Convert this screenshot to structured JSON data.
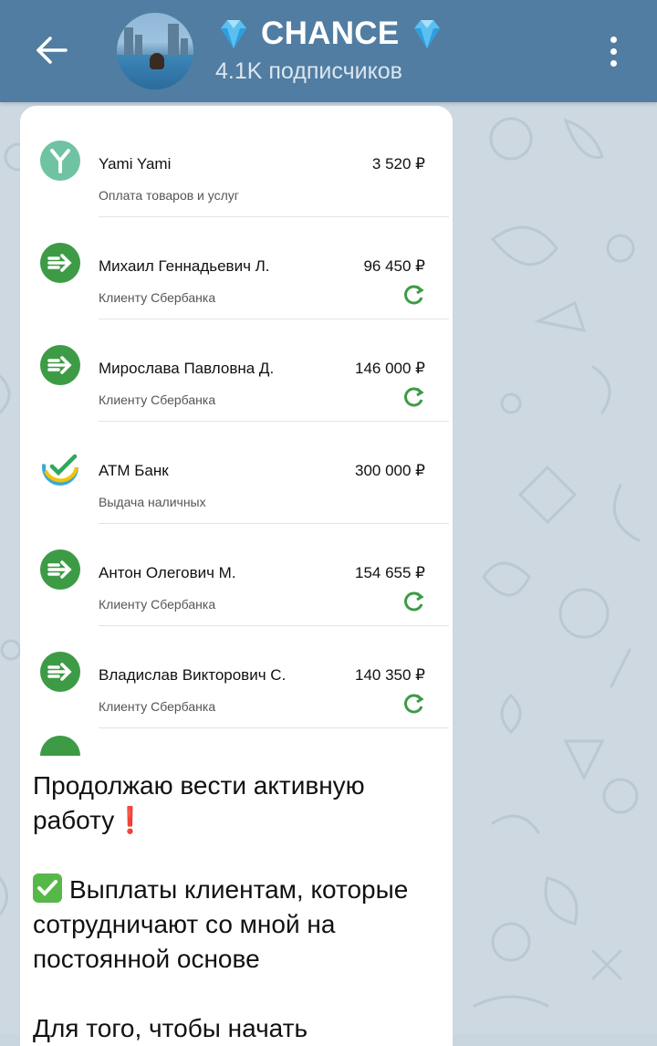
{
  "header": {
    "title": "CHANCE",
    "subtitle": "4.1K подписчиков",
    "left_emoji": "diamond-icon",
    "right_emoji": "diamond-icon",
    "color": "#517da2"
  },
  "transactions": [
    {
      "name": "Yami Yami",
      "amount": "3 520 ₽",
      "desc": "Оплата товаров и услуг",
      "icon": "yami-logo-icon",
      "repeat": false
    },
    {
      "name": "Михаил Геннадьевич Л.",
      "amount": "96 450 ₽",
      "desc": "Клиенту Сбербанка",
      "icon": "transfer-arrow-icon",
      "repeat": true
    },
    {
      "name": "Мирослава Павловна Д.",
      "amount": "146 000 ₽",
      "desc": "Клиенту Сбербанка",
      "icon": "transfer-arrow-icon",
      "repeat": true
    },
    {
      "name": "АТМ Банк",
      "amount": "300 000 ₽",
      "desc": "Выдача наличных",
      "icon": "sber-logo-icon",
      "repeat": false
    },
    {
      "name": "Антон Олегович М.",
      "amount": "154 655 ₽",
      "desc": "Клиенту Сбербанка",
      "icon": "transfer-arrow-icon",
      "repeat": true
    },
    {
      "name": "Владислав Викторович С.",
      "amount": "140 350 ₽",
      "desc": "Клиенту Сбербанка",
      "icon": "transfer-arrow-icon",
      "repeat": true
    }
  ],
  "message": {
    "line1": " Продолжаю вести активную работу",
    "line1_emoji": "❗",
    "line2_emoji": "check-mark-icon",
    "line2": "Выплаты клиентам, которые сотрудничают со мной на постоянной основе",
    "line3": "Для того, чтобы начать"
  },
  "colors": {
    "accent": "#517da2",
    "sber_green": "#3d9b45",
    "chat_bg": "#cdd8e1"
  }
}
